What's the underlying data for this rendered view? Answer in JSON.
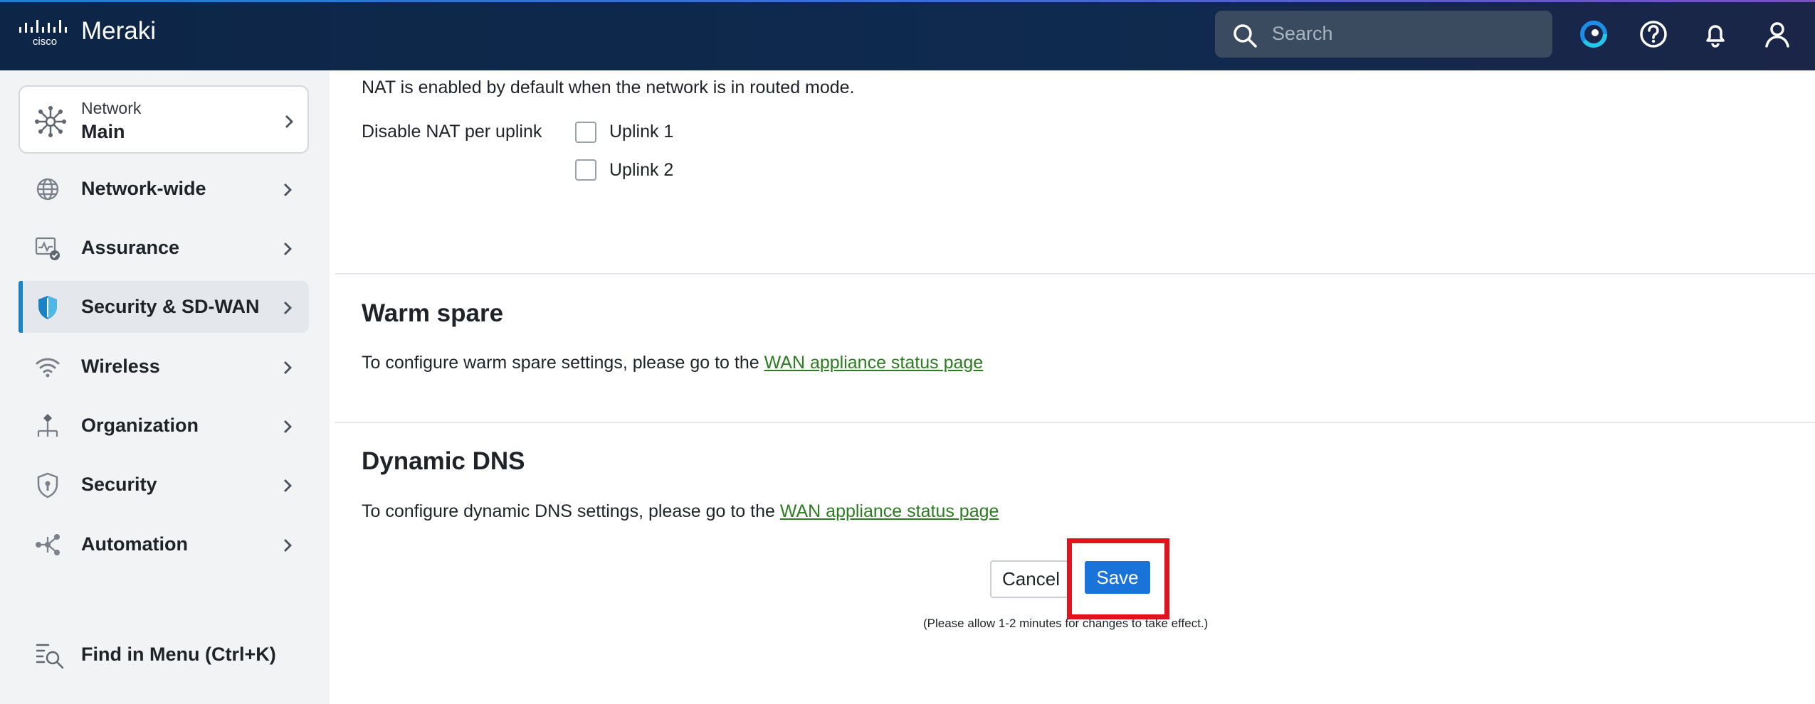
{
  "header": {
    "brand": "Meraki",
    "logo_text": "cisco",
    "search_placeholder": "Search",
    "icons": [
      "cisco-logo-icon",
      "search-icon",
      "ai-assistant-icon",
      "help-icon",
      "bell-icon",
      "user-icon"
    ]
  },
  "sidebar": {
    "network": {
      "caption": "Network",
      "name": "Main"
    },
    "items": [
      {
        "label": "Network-wide",
        "icon": "globe-icon"
      },
      {
        "label": "Assurance",
        "icon": "assurance-icon"
      },
      {
        "label": "Security & SD-WAN",
        "icon": "shield-icon",
        "active": true
      },
      {
        "label": "Wireless",
        "icon": "wifi-icon"
      },
      {
        "label": "Organization",
        "icon": "org-icon"
      },
      {
        "label": "Security",
        "icon": "security-icon"
      },
      {
        "label": "Automation",
        "icon": "automation-icon"
      }
    ],
    "find_menu": "Find in Menu (Ctrl+K)",
    "accent_color": "#1a83c6"
  },
  "main": {
    "nat_info": "NAT is enabled by default when the network is in routed mode.",
    "disable_nat_label": "Disable NAT per uplink",
    "uplinks": [
      {
        "label": "Uplink 1",
        "checked": false
      },
      {
        "label": "Uplink 2",
        "checked": false
      }
    ],
    "warm_spare": {
      "title": "Warm spare",
      "text": "To configure warm spare settings, please go to the",
      "link": "WAN appliance status page"
    },
    "dynamic_dns": {
      "title": "Dynamic DNS",
      "text": "To configure dynamic DNS settings, please go to the",
      "link": "WAN appliance status page"
    },
    "buttons": {
      "cancel": "Cancel",
      "save": "Save"
    },
    "note": "(Please allow 1-2 minutes for changes to take effect.)",
    "colors": {
      "save": "#1a73d9",
      "link": "#2a7d1f",
      "highlight": "#e0141e"
    }
  }
}
